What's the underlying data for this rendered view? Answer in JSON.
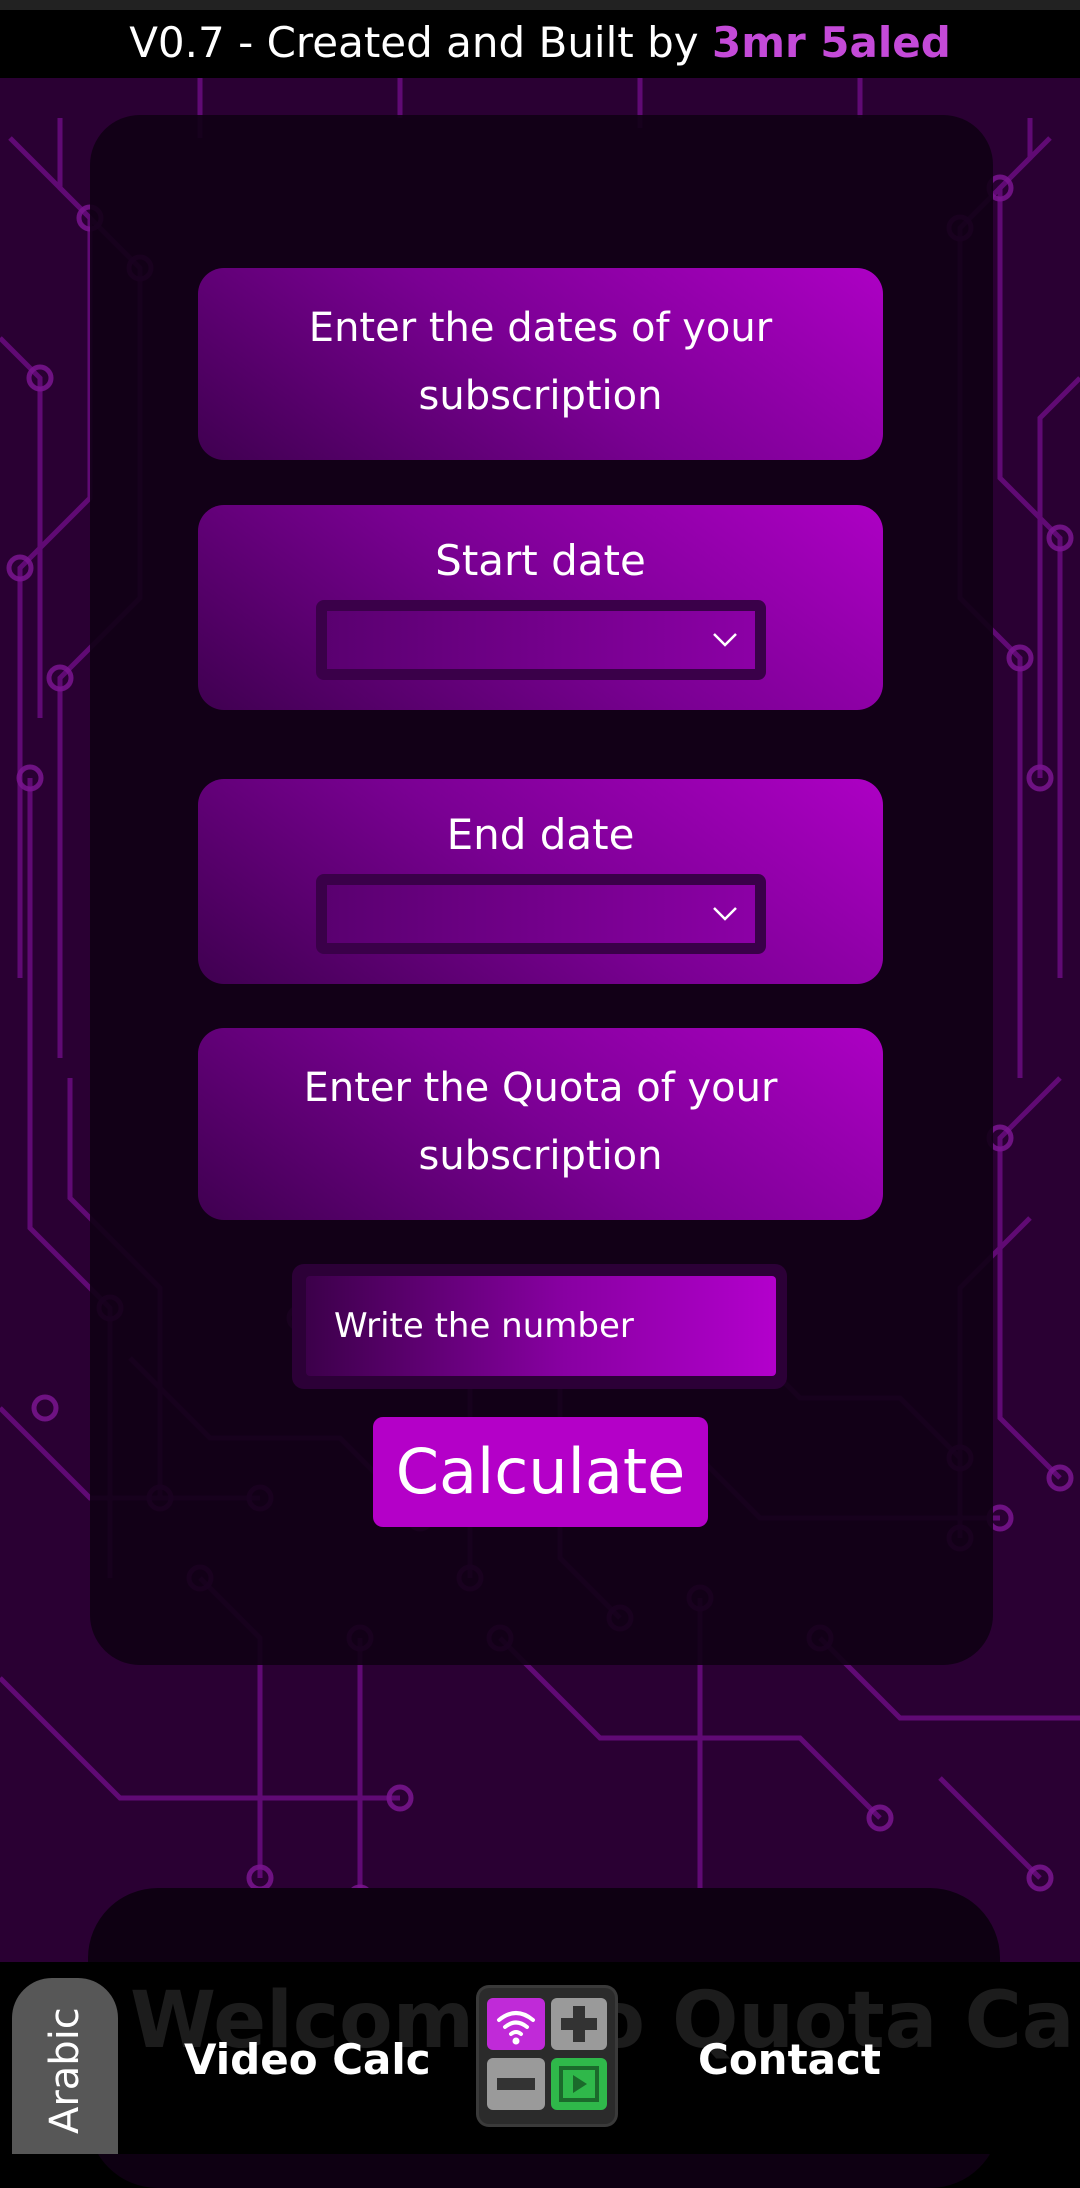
{
  "header": {
    "version_text": "V0.7 - Created and Built by ",
    "author": "3mr 5aled"
  },
  "form": {
    "intro_line1": "Enter the dates of your",
    "intro_line2": "subscription",
    "start_label": "Start date",
    "start_value": "",
    "end_label": "End date",
    "end_value": "",
    "quota_line1": "Enter the Quota of your",
    "quota_line2": "subscription",
    "number_placeholder": "Write the number",
    "calculate_label": "Calculate"
  },
  "welcome_title": "Welcome to Quota Calc",
  "nav": {
    "language": "Arabic",
    "video": "Video Calc",
    "contact": "Contact"
  },
  "colors": {
    "accent": "#b400c8",
    "author": "#c44ad8",
    "background": "#2a0033"
  },
  "icons": {
    "select_arrow": "chevron-down-icon",
    "home": "quota-calc-app-icon"
  }
}
